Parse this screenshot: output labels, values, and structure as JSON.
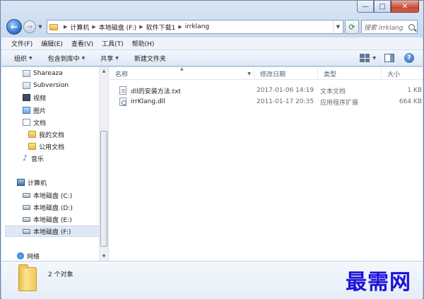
{
  "window": {
    "caption_minimize": "—",
    "caption_maximize": "□",
    "caption_close": "✕"
  },
  "address": {
    "crumbs": [
      "计算机",
      "本地磁盘 (F:)",
      "软件下载1",
      "irrklang"
    ],
    "search_placeholder": "搜索 irrklang"
  },
  "menubar": {
    "items": [
      "文件(F)",
      "编辑(E)",
      "查看(V)",
      "工具(T)",
      "帮助(H)"
    ]
  },
  "toolbar": {
    "organize": "组织",
    "include_library": "包含到库中",
    "share": "共享",
    "new_folder": "新建文件夹"
  },
  "nav": {
    "items": [
      {
        "label": "Shareaza",
        "icon": "folder-icon"
      },
      {
        "label": "Subversion",
        "icon": "folder-icon"
      },
      {
        "label": "视频",
        "icon": "video-library-icon"
      },
      {
        "label": "图片",
        "icon": "picture-library-icon"
      },
      {
        "label": "文档",
        "icon": "document-library-icon"
      },
      {
        "label": "我的文档",
        "icon": "folder-icon"
      },
      {
        "label": "公用文档",
        "icon": "folder-icon"
      },
      {
        "label": "音乐",
        "icon": "music-library-icon"
      },
      {
        "label": "计算机",
        "icon": "computer-icon"
      },
      {
        "label": "本地磁盘 (C:)",
        "icon": "drive-icon"
      },
      {
        "label": "本地磁盘 (D:)",
        "icon": "drive-icon"
      },
      {
        "label": "本地磁盘 (E:)",
        "icon": "drive-icon"
      },
      {
        "label": "本地磁盘 (F:)",
        "icon": "drive-icon",
        "selected": true
      },
      {
        "label": "网络",
        "icon": "network-icon"
      }
    ]
  },
  "columns": {
    "name": "名称",
    "date": "修改日期",
    "type": "类型",
    "size": "大小"
  },
  "files": [
    {
      "name": "dll的安装方法.txt",
      "date": "2017-01-06 14:19",
      "type": "文本文档",
      "size": "1 KB",
      "icon": "text-file-icon"
    },
    {
      "name": "irrKlang.dll",
      "date": "2011-01-17 20:35",
      "type": "应用程序扩展",
      "size": "664 KB",
      "icon": "dll-file-icon"
    }
  ],
  "details": {
    "count": "2 个对象"
  },
  "watermark": "最需网"
}
